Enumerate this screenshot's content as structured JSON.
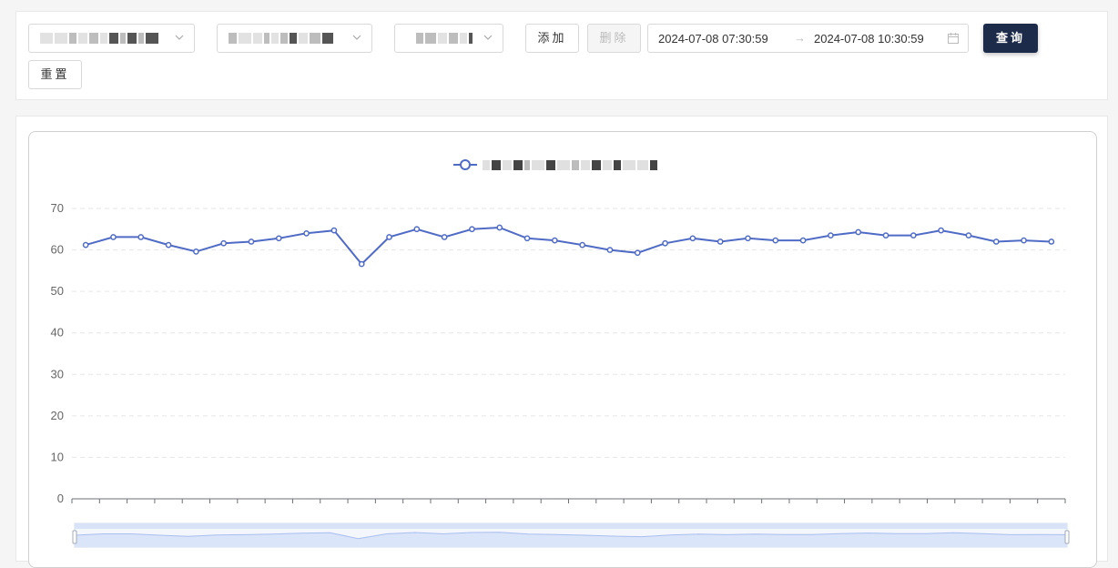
{
  "filters": {
    "add_label": "添加",
    "delete_label": "删除",
    "query_label": "查询",
    "reset_label": "重置",
    "date_start": "2024-07-08 07:30:59",
    "date_arrow": "→",
    "date_end": "2024-07-08 10:30:59"
  },
  "colors": {
    "series": "#4f6bc6",
    "primary": "#1c2b4a",
    "zoom_fill": "#dbe5fa"
  },
  "chart_data": {
    "type": "line",
    "title": "",
    "xlabel": "",
    "ylabel": "",
    "ylim": [
      0,
      70
    ],
    "yticks": [
      "0",
      "10",
      "20",
      "30",
      "40",
      "50",
      "60",
      "70"
    ],
    "grid": "dashed-horizontal",
    "legend": "top-center",
    "dataZoom": "bottom slider",
    "series": [
      {
        "values": [
          61.2,
          63.1,
          63.1,
          61.2,
          59.6,
          61.6,
          62.0,
          62.8,
          64.0,
          64.7,
          56.6,
          63.1,
          65.0,
          63.1,
          65.0,
          65.4,
          62.8,
          62.3,
          61.2,
          60.0,
          59.3,
          61.6,
          62.8,
          62.0,
          62.8,
          62.3,
          62.3,
          63.5,
          64.3,
          63.5,
          63.5,
          64.7,
          63.5,
          62.0,
          62.3,
          62.0
        ]
      }
    ]
  }
}
